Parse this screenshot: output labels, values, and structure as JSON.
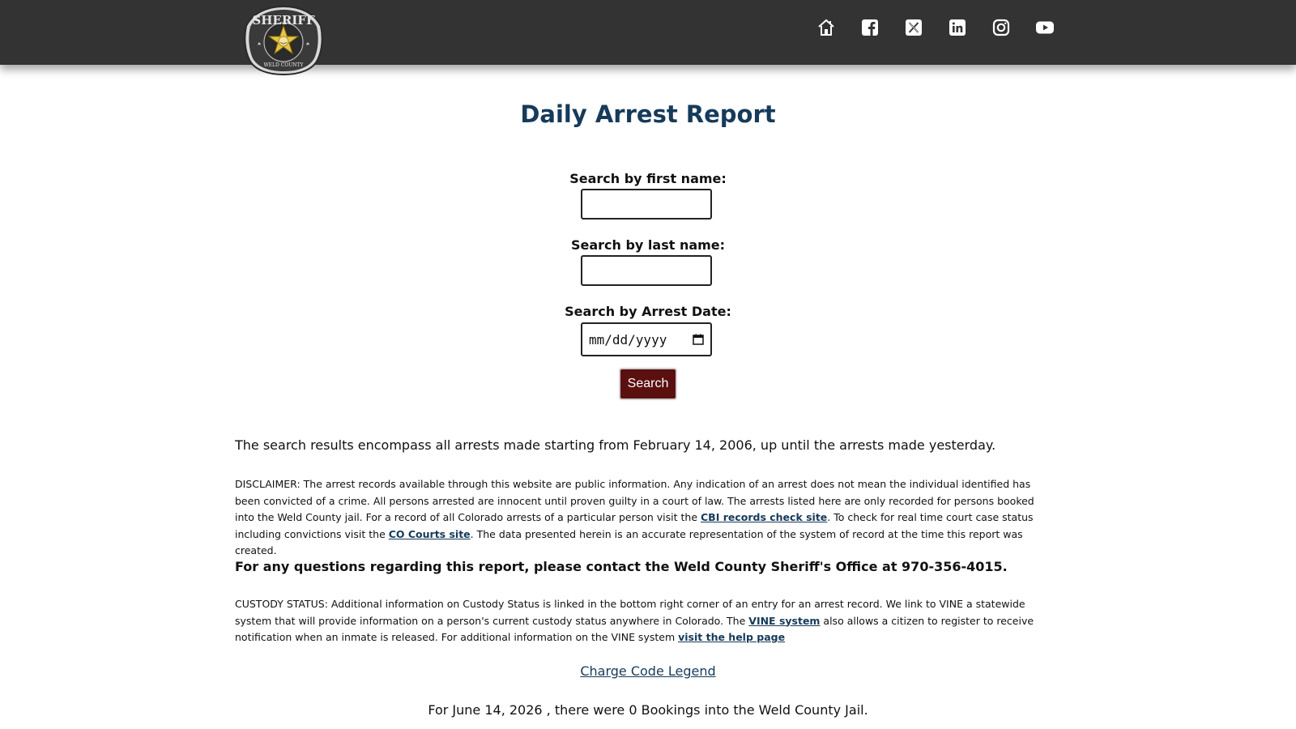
{
  "header": {
    "logo_alt": "SHERIFF WELD COUNTY",
    "logo_top_text": "SHERIFF",
    "logo_bottom_text": "WELD COUNTY",
    "social_icons": [
      "home-icon",
      "facebook-icon",
      "x-twitter-icon",
      "linkedin-icon",
      "instagram-icon",
      "youtube-icon"
    ]
  },
  "page": {
    "title": "Daily Arrest Report"
  },
  "search": {
    "first_name_label": "Search by first name:",
    "first_name_value": "",
    "last_name_label": "Search by last name:",
    "last_name_value": "",
    "date_label": "Search by Arrest Date:",
    "date_placeholder": "mm/dd/yyyy",
    "button_label": "Search"
  },
  "info": {
    "lead": "The search results encompass all arrests made starting from February 14, 2006, up until the arrests made yesterday.",
    "disclaimer_1": "DISCLAIMER: The arrest records available through this website are public information. Any indication of an arrest does not mean the individual identified has been convicted of a crime. All persons arrested are innocent until proven guilty in a court of law. The arrests listed here are only recorded for persons booked into the Weld County jail. For a record of all Colorado arrests of a particular person visit the ",
    "cbi_link": "CBI records check site",
    "disclaimer_2": ".  To check for real time court case status including convictions visit the ",
    "courts_link": "CO Courts site",
    "disclaimer_3": ". The data presented herein is an accurate representation of the system of record at the time this report was created.",
    "contact": "For any questions regarding this report, please contact the Weld County Sheriff's Office at 970-356-4015.",
    "custody_1": "CUSTODY STATUS: Additional information on Custody Status is linked in the bottom right corner of an entry for an arrest record. We link to VINE a statewide system that will provide information on a person's current custody status anywhere in Colorado. The ",
    "vine_link": "VINE system",
    "custody_2": " also allows a citizen to register to receive notification when an inmate is released. For additional information on the VINE system ",
    "help_link": "visit the help page",
    "legend_link": "Charge Code Legend",
    "bookings": "For June 14, 2026 , there were 0 Bookings into the Weld County Jail."
  },
  "colors": {
    "header_bg": "#333333",
    "title": "#163a5a",
    "button_bg": "#5b1010",
    "link": "#163a5a"
  }
}
